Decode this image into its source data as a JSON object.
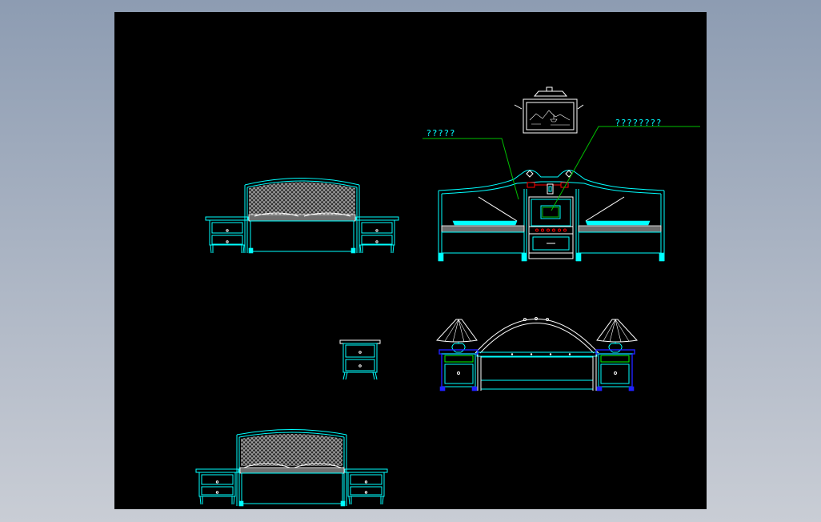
{
  "drawing": {
    "labels": {
      "panel_callout": "?????",
      "console_callout": "????????"
    }
  },
  "colors": {
    "canvas": "#000000",
    "primary_line": "#00ffff",
    "leader_line": "#00c000",
    "accent_red": "#ff0000",
    "accent_blue": "#2020ff",
    "white_line": "#ffffff",
    "frame_top": "#8d9cb2",
    "frame_bottom": "#c9cdd5"
  }
}
